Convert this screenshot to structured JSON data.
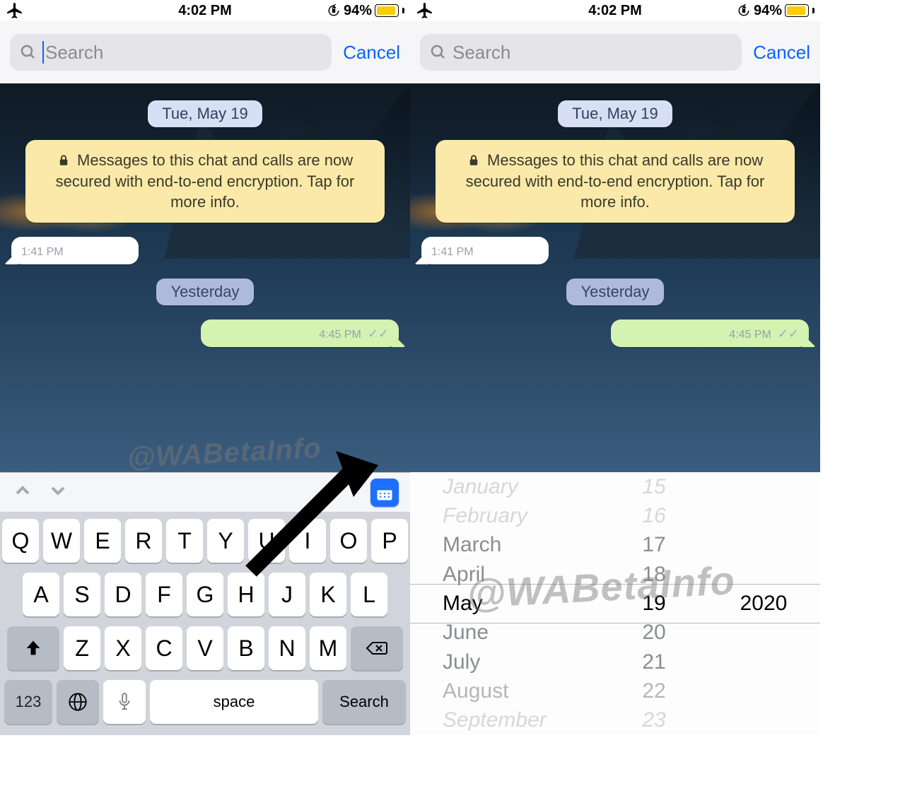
{
  "status": {
    "time": "4:02 PM",
    "battery_pct": "94%",
    "battery_fill": 94
  },
  "search": {
    "placeholder": "Search",
    "cancel": "Cancel"
  },
  "chat": {
    "date_pill": "Tue, May 19",
    "encryption_notice": "Messages to this chat and calls are now secured with end-to-end encryption. Tap for more info.",
    "incoming_time": "1:41 PM",
    "yesterday_label": "Yesterday",
    "outgoing_time": "4:45 PM"
  },
  "watermark": "@WABetaInfo",
  "keyboard": {
    "row1": [
      "Q",
      "W",
      "E",
      "R",
      "T",
      "Y",
      "U",
      "I",
      "O",
      "P"
    ],
    "row2": [
      "A",
      "S",
      "D",
      "F",
      "G",
      "H",
      "J",
      "K",
      "L"
    ],
    "row3": [
      "Z",
      "X",
      "C",
      "V",
      "B",
      "N",
      "M"
    ],
    "num_key": "123",
    "space": "space",
    "search": "Search"
  },
  "picker": {
    "months_above": [
      "January",
      "February",
      "March",
      "April"
    ],
    "month_selected": "May",
    "months_below": [
      "June",
      "July",
      "August",
      "September"
    ],
    "days_above": [
      "15",
      "16",
      "17",
      "18"
    ],
    "day_selected": "19",
    "days_below": [
      "20",
      "21",
      "22",
      "23"
    ],
    "year_selected": "2020"
  }
}
